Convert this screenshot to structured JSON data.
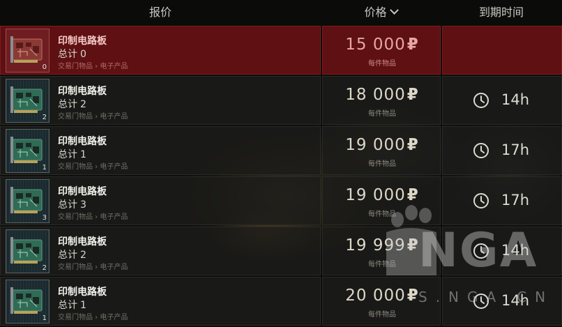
{
  "header": {
    "offer_label": "报价",
    "price_label": "价格",
    "expire_label": "到期时间"
  },
  "offers": [
    {
      "name": "印制电路板",
      "total_label": "总计",
      "total": "0",
      "category": "交易门物品 › 电子产品",
      "count": "0",
      "price": "15 000",
      "currency": "₽",
      "per_item": "每件物品",
      "expires": "",
      "selected": true
    },
    {
      "name": "印制电路板",
      "total_label": "总计",
      "total": "2",
      "category": "交易门物品 › 电子产品",
      "count": "2",
      "price": "18 000",
      "currency": "₽",
      "per_item": "每件物品",
      "expires": "14h",
      "selected": false
    },
    {
      "name": "印制电路板",
      "total_label": "总计",
      "total": "1",
      "category": "交易门物品 › 电子产品",
      "count": "1",
      "price": "19 000",
      "currency": "₽",
      "per_item": "每件物品",
      "expires": "17h",
      "selected": false
    },
    {
      "name": "印制电路板",
      "total_label": "总计",
      "total": "3",
      "category": "交易门物品 › 电子产品",
      "count": "3",
      "price": "19 000",
      "currency": "₽",
      "per_item": "每件物品",
      "expires": "17h",
      "selected": false
    },
    {
      "name": "印制电路板",
      "total_label": "总计",
      "total": "2",
      "category": "交易门物品 › 电子产品",
      "count": "2",
      "price": "19 999",
      "currency": "₽",
      "per_item": "每件物品",
      "expires": "14h",
      "selected": false
    },
    {
      "name": "印制电路板",
      "total_label": "总计",
      "total": "1",
      "category": "交易门物品 › 电子产品",
      "count": "1",
      "price": "20 000",
      "currency": "₽",
      "per_item": "每件物品",
      "expires": "14h",
      "selected": false
    }
  ],
  "watermark": {
    "logo": "NGA",
    "site": "S.NGA.CN"
  },
  "icons": {
    "sort": "chevron-down-icon",
    "item": "circuit-board-icon",
    "timer": "clock-icon"
  },
  "colors": {
    "selected_row": "#5e1012",
    "row_bg": "#1c1c1a",
    "header_bg": "#0b0b0a",
    "item_thumb": "#1a2a2e"
  }
}
